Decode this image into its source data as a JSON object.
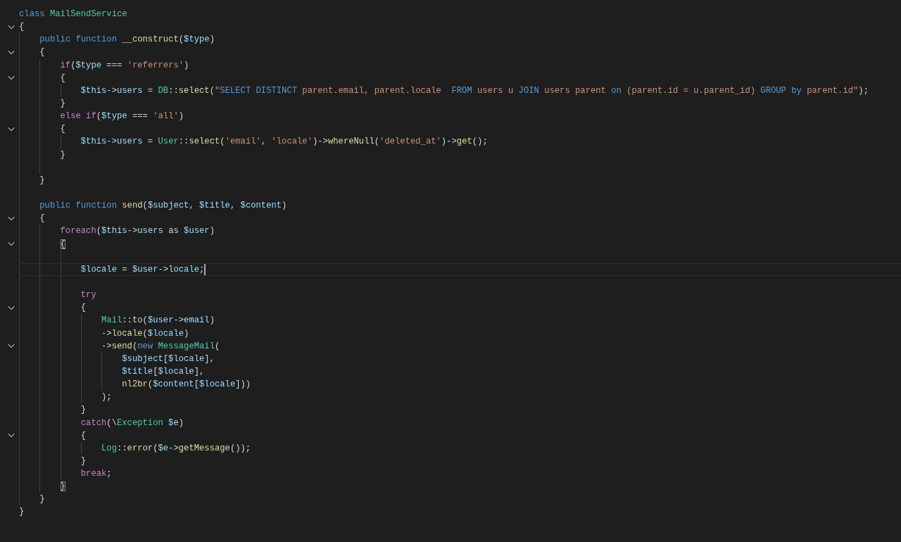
{
  "editor": {
    "lines": [
      {
        "fold": false,
        "current": false,
        "tokens": [
          {
            "t": "class ",
            "kind": "kw"
          },
          {
            "t": "MailSendService",
            "kind": "cls"
          }
        ]
      },
      {
        "fold": true,
        "current": false,
        "tokens": [
          {
            "t": "{",
            "kind": "p"
          }
        ],
        "children": [
          {
            "fold": false,
            "current": false,
            "tokens": [
              {
                "t": "public function ",
                "kind": "kw"
              },
              {
                "t": "__construct",
                "kind": "fn"
              },
              {
                "t": "(",
                "kind": "p"
              },
              {
                "t": "$type",
                "kind": "var"
              },
              {
                "t": ")",
                "kind": "p"
              }
            ]
          },
          {
            "fold": true,
            "current": false,
            "tokens": [
              {
                "t": "{",
                "kind": "p"
              }
            ],
            "children": [
              {
                "fold": false,
                "current": false,
                "tokens": [
                  {
                    "t": "if",
                    "kind": "ctl"
                  },
                  {
                    "t": "(",
                    "kind": "p"
                  },
                  {
                    "t": "$type",
                    "kind": "var"
                  },
                  {
                    "t": " === ",
                    "kind": "p"
                  },
                  {
                    "t": "'referrers'",
                    "kind": "str"
                  },
                  {
                    "t": ")",
                    "kind": "p"
                  }
                ]
              },
              {
                "fold": true,
                "current": false,
                "tokens": [
                  {
                    "t": "{",
                    "kind": "p"
                  }
                ],
                "children": [
                  {
                    "fold": false,
                    "current": false,
                    "tokens": [
                      {
                        "t": "$this",
                        "kind": "var"
                      },
                      {
                        "t": "->",
                        "kind": "p"
                      },
                      {
                        "t": "users",
                        "kind": "var"
                      },
                      {
                        "t": " = ",
                        "kind": "p"
                      },
                      {
                        "t": "DB",
                        "kind": "cls"
                      },
                      {
                        "t": "::",
                        "kind": "p"
                      },
                      {
                        "t": "select",
                        "kind": "fn"
                      },
                      {
                        "t": "(",
                        "kind": "p"
                      },
                      {
                        "t": "\"",
                        "kind": "str"
                      },
                      {
                        "t": "SELECT DISTINCT",
                        "kind": "kw"
                      },
                      {
                        "t": " parent.email, parent.locale  ",
                        "kind": "str"
                      },
                      {
                        "t": "FROM",
                        "kind": "kw"
                      },
                      {
                        "t": " users u ",
                        "kind": "str"
                      },
                      {
                        "t": "JOIN",
                        "kind": "kw"
                      },
                      {
                        "t": " users parent ",
                        "kind": "str"
                      },
                      {
                        "t": "on",
                        "kind": "kw"
                      },
                      {
                        "t": " (parent.id = u.parent_id) ",
                        "kind": "str"
                      },
                      {
                        "t": "GROUP by",
                        "kind": "kw"
                      },
                      {
                        "t": " parent.id\"",
                        "kind": "str"
                      },
                      {
                        "t": ");",
                        "kind": "p"
                      }
                    ]
                  }
                ]
              },
              {
                "fold": false,
                "current": false,
                "tokens": [
                  {
                    "t": "}",
                    "kind": "p"
                  }
                ]
              },
              {
                "fold": false,
                "current": false,
                "tokens": [
                  {
                    "t": "else if",
                    "kind": "ctl"
                  },
                  {
                    "t": "(",
                    "kind": "p"
                  },
                  {
                    "t": "$type",
                    "kind": "var"
                  },
                  {
                    "t": " === ",
                    "kind": "p"
                  },
                  {
                    "t": "'all'",
                    "kind": "str"
                  },
                  {
                    "t": ")",
                    "kind": "p"
                  }
                ]
              },
              {
                "fold": true,
                "current": false,
                "tokens": [
                  {
                    "t": "{",
                    "kind": "p"
                  }
                ],
                "children": [
                  {
                    "fold": false,
                    "current": false,
                    "tokens": [
                      {
                        "t": "$this",
                        "kind": "var"
                      },
                      {
                        "t": "->",
                        "kind": "p"
                      },
                      {
                        "t": "users",
                        "kind": "var"
                      },
                      {
                        "t": " = ",
                        "kind": "p"
                      },
                      {
                        "t": "User",
                        "kind": "cls"
                      },
                      {
                        "t": "::",
                        "kind": "p"
                      },
                      {
                        "t": "select",
                        "kind": "fn"
                      },
                      {
                        "t": "(",
                        "kind": "p"
                      },
                      {
                        "t": "'email'",
                        "kind": "str"
                      },
                      {
                        "t": ", ",
                        "kind": "p"
                      },
                      {
                        "t": "'locale'",
                        "kind": "str"
                      },
                      {
                        "t": ")->",
                        "kind": "p"
                      },
                      {
                        "t": "whereNull",
                        "kind": "fn"
                      },
                      {
                        "t": "(",
                        "kind": "p"
                      },
                      {
                        "t": "'deleted_at'",
                        "kind": "str"
                      },
                      {
                        "t": ")->",
                        "kind": "p"
                      },
                      {
                        "t": "get",
                        "kind": "fn"
                      },
                      {
                        "t": "();",
                        "kind": "p"
                      }
                    ]
                  }
                ]
              },
              {
                "fold": false,
                "current": false,
                "tokens": [
                  {
                    "t": "}",
                    "kind": "p"
                  }
                ]
              },
              {
                "fold": false,
                "current": false
              }
            ]
          },
          {
            "fold": false,
            "current": false,
            "tokens": [
              {
                "t": "}",
                "kind": "p"
              }
            ]
          },
          {
            "fold": false,
            "current": false
          },
          {
            "fold": false,
            "current": false,
            "tokens": [
              {
                "t": "public function ",
                "kind": "kw"
              },
              {
                "t": "send",
                "kind": "fn"
              },
              {
                "t": "(",
                "kind": "p"
              },
              {
                "t": "$subject",
                "kind": "var"
              },
              {
                "t": ", ",
                "kind": "p"
              },
              {
                "t": "$title",
                "kind": "var"
              },
              {
                "t": ", ",
                "kind": "p"
              },
              {
                "t": "$content",
                "kind": "var"
              },
              {
                "t": ")",
                "kind": "p"
              }
            ]
          },
          {
            "fold": true,
            "current": false,
            "tokens": [
              {
                "t": "{",
                "kind": "p"
              }
            ],
            "children": [
              {
                "fold": false,
                "current": false,
                "tokens": [
                  {
                    "t": "foreach",
                    "kind": "ctl"
                  },
                  {
                    "t": "(",
                    "kind": "p"
                  },
                  {
                    "t": "$this",
                    "kind": "var"
                  },
                  {
                    "t": "->",
                    "kind": "p"
                  },
                  {
                    "t": "users",
                    "kind": "var"
                  },
                  {
                    "t": " as ",
                    "kind": "p"
                  },
                  {
                    "t": "$user",
                    "kind": "var"
                  },
                  {
                    "t": ")",
                    "kind": "p"
                  }
                ]
              },
              {
                "fold": true,
                "current": false,
                "tokens": [
                  {
                    "t": "{",
                    "kind": "match"
                  }
                ],
                "children": [
                  {
                    "fold": false,
                    "current": false
                  },
                  {
                    "fold": false,
                    "current": true,
                    "tokens": [
                      {
                        "t": "$locale",
                        "kind": "var"
                      },
                      {
                        "t": " = ",
                        "kind": "p"
                      },
                      {
                        "t": "$user",
                        "kind": "var"
                      },
                      {
                        "t": "->",
                        "kind": "p"
                      },
                      {
                        "t": "locale",
                        "kind": "var"
                      },
                      {
                        "t": ";",
                        "kind": "p"
                      }
                    ]
                  },
                  {
                    "fold": false,
                    "current": false
                  },
                  {
                    "fold": false,
                    "current": false,
                    "tokens": [
                      {
                        "t": "try",
                        "kind": "ctl"
                      }
                    ]
                  },
                  {
                    "fold": true,
                    "current": false,
                    "tokens": [
                      {
                        "t": "{",
                        "kind": "p"
                      }
                    ],
                    "children": [
                      {
                        "fold": false,
                        "current": false,
                        "tokens": [
                          {
                            "t": "Mail",
                            "kind": "cls"
                          },
                          {
                            "t": "::",
                            "kind": "p"
                          },
                          {
                            "t": "to",
                            "kind": "fn"
                          },
                          {
                            "t": "(",
                            "kind": "p"
                          },
                          {
                            "t": "$user",
                            "kind": "var"
                          },
                          {
                            "t": "->",
                            "kind": "p"
                          },
                          {
                            "t": "email",
                            "kind": "var"
                          },
                          {
                            "t": ")",
                            "kind": "p"
                          }
                        ]
                      },
                      {
                        "fold": false,
                        "current": false,
                        "tokens": [
                          {
                            "t": "->",
                            "kind": "p"
                          },
                          {
                            "t": "locale",
                            "kind": "fn"
                          },
                          {
                            "t": "(",
                            "kind": "p"
                          },
                          {
                            "t": "$locale",
                            "kind": "var"
                          },
                          {
                            "t": ")",
                            "kind": "p"
                          }
                        ]
                      },
                      {
                        "fold": true,
                        "current": false,
                        "tokens": [
                          {
                            "t": "->",
                            "kind": "p"
                          },
                          {
                            "t": "send",
                            "kind": "fn"
                          },
                          {
                            "t": "(",
                            "kind": "p"
                          },
                          {
                            "t": "new ",
                            "kind": "kw"
                          },
                          {
                            "t": "MessageMail",
                            "kind": "cls"
                          },
                          {
                            "t": "(",
                            "kind": "p"
                          }
                        ],
                        "children": [
                          {
                            "fold": false,
                            "current": false,
                            "tokens": [
                              {
                                "t": "$subject",
                                "kind": "var"
                              },
                              {
                                "t": "[",
                                "kind": "p"
                              },
                              {
                                "t": "$locale",
                                "kind": "var"
                              },
                              {
                                "t": "],",
                                "kind": "p"
                              }
                            ]
                          },
                          {
                            "fold": false,
                            "current": false,
                            "tokens": [
                              {
                                "t": "$title",
                                "kind": "var"
                              },
                              {
                                "t": "[",
                                "kind": "p"
                              },
                              {
                                "t": "$locale",
                                "kind": "var"
                              },
                              {
                                "t": "],",
                                "kind": "p"
                              }
                            ]
                          },
                          {
                            "fold": false,
                            "current": false,
                            "tokens": [
                              {
                                "t": "nl2br",
                                "kind": "fn"
                              },
                              {
                                "t": "(",
                                "kind": "p"
                              },
                              {
                                "t": "$content",
                                "kind": "var"
                              },
                              {
                                "t": "[",
                                "kind": "p"
                              },
                              {
                                "t": "$locale",
                                "kind": "var"
                              },
                              {
                                "t": "]))",
                                "kind": "p"
                              }
                            ]
                          }
                        ]
                      },
                      {
                        "fold": false,
                        "current": false,
                        "tokens": [
                          {
                            "t": ");",
                            "kind": "p"
                          }
                        ]
                      }
                    ]
                  },
                  {
                    "fold": false,
                    "current": false,
                    "tokens": [
                      {
                        "t": "}",
                        "kind": "p"
                      }
                    ]
                  },
                  {
                    "fold": false,
                    "current": false,
                    "tokens": [
                      {
                        "t": "catch",
                        "kind": "ctl"
                      },
                      {
                        "t": "(\\",
                        "kind": "p"
                      },
                      {
                        "t": "Exception ",
                        "kind": "cls"
                      },
                      {
                        "t": "$e",
                        "kind": "var"
                      },
                      {
                        "t": ")",
                        "kind": "p"
                      }
                    ]
                  },
                  {
                    "fold": true,
                    "current": false,
                    "tokens": [
                      {
                        "t": "{",
                        "kind": "p"
                      }
                    ],
                    "children": [
                      {
                        "fold": false,
                        "current": false,
                        "tokens": [
                          {
                            "t": "Log",
                            "kind": "cls"
                          },
                          {
                            "t": "::",
                            "kind": "p"
                          },
                          {
                            "t": "error",
                            "kind": "fn"
                          },
                          {
                            "t": "(",
                            "kind": "p"
                          },
                          {
                            "t": "$e",
                            "kind": "var"
                          },
                          {
                            "t": "->",
                            "kind": "p"
                          },
                          {
                            "t": "getMessage",
                            "kind": "fn"
                          },
                          {
                            "t": "());",
                            "kind": "p"
                          }
                        ]
                      }
                    ]
                  },
                  {
                    "fold": false,
                    "current": false,
                    "tokens": [
                      {
                        "t": "}",
                        "kind": "p"
                      }
                    ]
                  },
                  {
                    "fold": false,
                    "current": false,
                    "tokens": [
                      {
                        "t": "break",
                        "kind": "ctl"
                      },
                      {
                        "t": ";",
                        "kind": "p"
                      }
                    ]
                  }
                ]
              },
              {
                "fold": false,
                "current": false,
                "tokens": [
                  {
                    "t": "}",
                    "kind": "match"
                  }
                ]
              }
            ]
          },
          {
            "fold": false,
            "current": false,
            "tokens": [
              {
                "t": "}",
                "kind": "p"
              }
            ]
          }
        ]
      },
      {
        "fold": false,
        "current": false,
        "tokens": [
          {
            "t": "}",
            "kind": "p"
          }
        ]
      }
    ]
  }
}
